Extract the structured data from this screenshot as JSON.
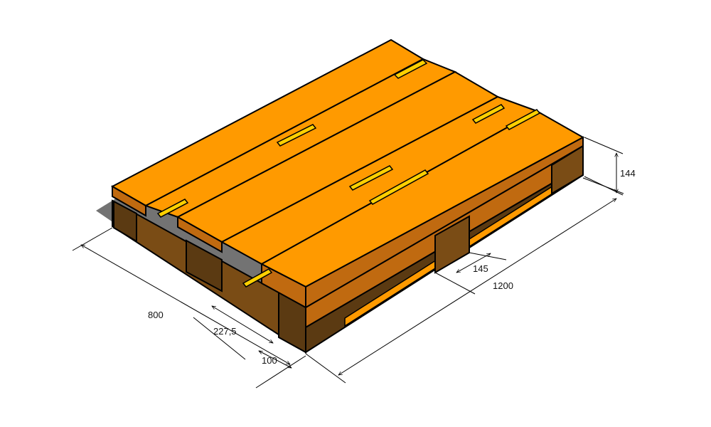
{
  "diagram": {
    "subject": "pallet",
    "colors": {
      "board_top": "#FF9A00",
      "board_side": "#C06A10",
      "block_front": "#5B3A12",
      "block_side": "#7A4C15",
      "highlight": "#FFD000",
      "shadow": "#555555",
      "outline": "#000000"
    },
    "dimensions": {
      "height": "144",
      "length": "1200",
      "width": "800",
      "gap": "145",
      "board_width": "227,5",
      "block_width": "100"
    }
  }
}
